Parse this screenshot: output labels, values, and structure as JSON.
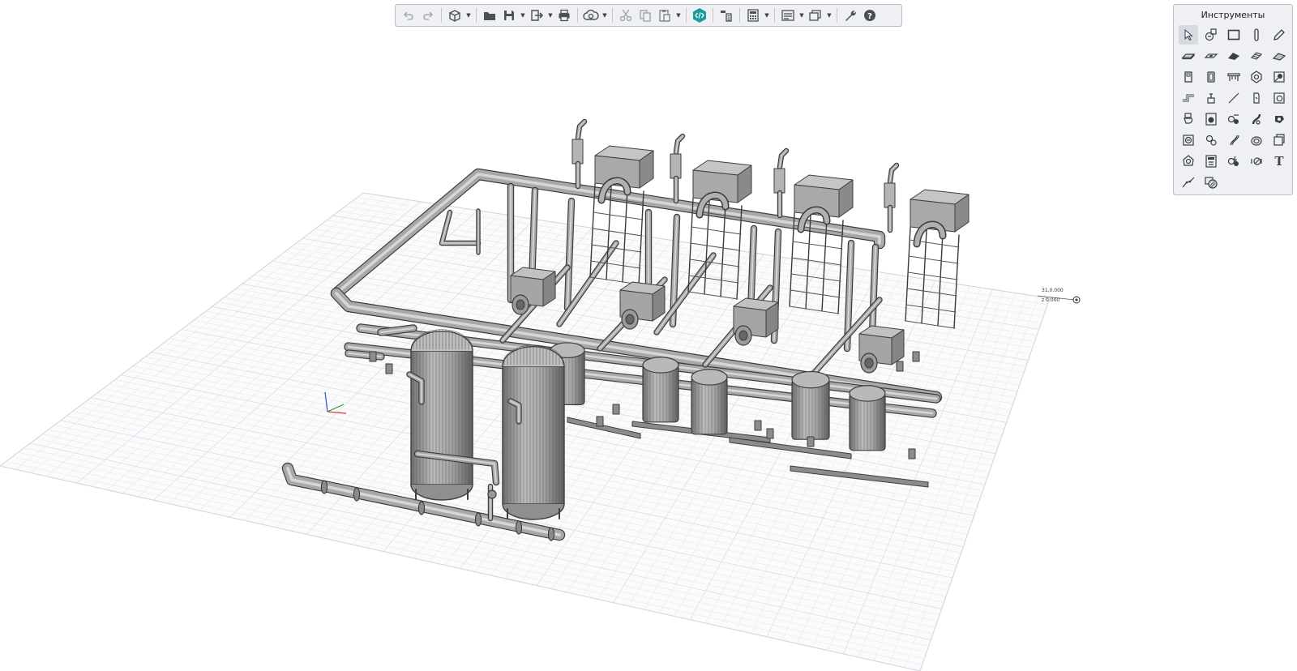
{
  "app": {
    "toolbar": {
      "buttons": [
        {
          "name": "undo-icon"
        },
        {
          "name": "redo-icon"
        },
        {
          "name": "3d-view-icon",
          "has_dropdown": true
        },
        {
          "name": "open-folder-icon"
        },
        {
          "name": "save-icon",
          "has_dropdown": true
        },
        {
          "name": "export-icon",
          "has_dropdown": true
        },
        {
          "name": "print-icon"
        },
        {
          "name": "cloud-sync-icon",
          "has_dropdown": true
        },
        {
          "name": "cut-icon"
        },
        {
          "name": "copy-icon"
        },
        {
          "name": "paste-icon",
          "has_dropdown": true
        },
        {
          "name": "code-icon"
        },
        {
          "name": "layers-icon"
        },
        {
          "name": "calculator-icon",
          "has_dropdown": true
        },
        {
          "name": "list-icon",
          "has_dropdown": true
        },
        {
          "name": "windows-icon",
          "has_dropdown": true
        },
        {
          "name": "wrench-icon"
        },
        {
          "name": "help-icon"
        }
      ]
    },
    "tools_panel": {
      "title": "Инструменты",
      "text_tool_label": "T"
    },
    "viewport": {
      "coord_x": "31,0.000",
      "coord_z": "z 0.000"
    },
    "colors": {
      "accent": "#1a9c9c",
      "grid_line": "#dadde2",
      "model_fill": "#9a9a9a",
      "model_stroke": "#4a4a4a"
    }
  }
}
